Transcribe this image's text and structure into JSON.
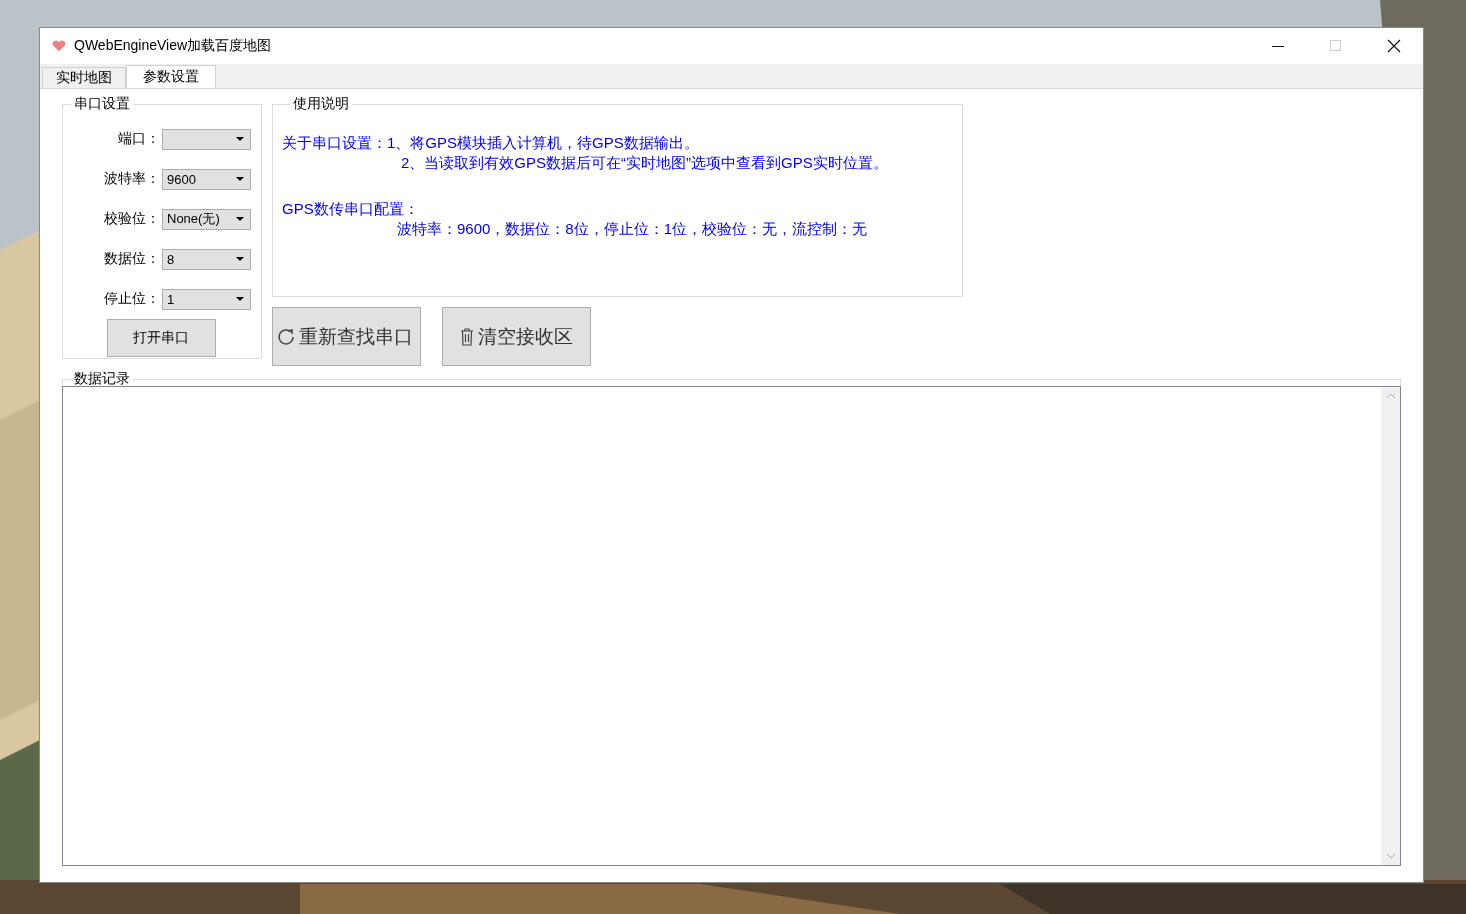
{
  "window": {
    "title": "QWebEngineView加载百度地图"
  },
  "tabs": [
    {
      "label": "实时地图",
      "selected": false
    },
    {
      "label": "参数设置",
      "selected": true
    }
  ],
  "serial_settings": {
    "title": "串口设置",
    "fields": [
      {
        "label": "端口："
      },
      {
        "label": "波特率：",
        "value": "9600"
      },
      {
        "label": "校验位：",
        "value": "None(无)"
      },
      {
        "label": "数据位：",
        "value": "8"
      },
      {
        "label": "停止位：",
        "value": "1"
      }
    ],
    "open_button": "打开串口"
  },
  "usage": {
    "title": "使用说明",
    "sections": [
      {
        "kind": "inline",
        "heading": "关于串口设置：",
        "lines": [
          "1、将GPS模块插入计算机，待GPS数据输出。",
          "2、当读取到有效GPS数据后可在“实时地图”选项中查看到GPS实时位置。"
        ]
      },
      {
        "kind": "block",
        "heading": "GPS数传串口配置：",
        "lines": [
          "波特率：9600，数据位：8位，停止位：1位，校验位：无，流控制：无"
        ]
      }
    ]
  },
  "actions": [
    {
      "kind": "refresh",
      "label": "重新查找串口"
    },
    {
      "kind": "trash",
      "label": "清空接收区"
    }
  ],
  "data_log": {
    "title": "数据记录"
  }
}
